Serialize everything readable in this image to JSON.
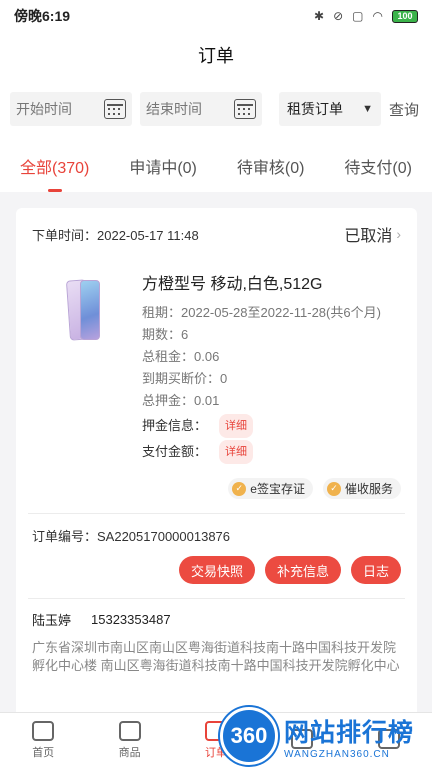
{
  "status_bar": {
    "time": "傍晚6:19",
    "battery": "100"
  },
  "header": {
    "title": "订单"
  },
  "filters": {
    "start_placeholder": "开始时间",
    "end_placeholder": "结束时间",
    "type_selected": "租赁订单",
    "query_label": "查询"
  },
  "tabs": [
    {
      "label": "全部(370)"
    },
    {
      "label": "申请中(0)"
    },
    {
      "label": "待审核(0)"
    },
    {
      "label": "待支付(0)"
    }
  ],
  "order": {
    "order_time": "下单时间：2022-05-17 11:48",
    "status": "已取消",
    "product_title": "方橙型号 移动,白色,512G",
    "rent_period": "租期：2022-05-28至2022-11-28(共6个月)",
    "installments": "期数：6",
    "total_rent": "总租金：0.06",
    "buyout_price": "到期买断价：0",
    "total_deposit": "总押金：0.01",
    "deposit_info_label": "押金信息：",
    "payment_label": "支付金额：",
    "detail_tag": "详细",
    "services": [
      "e签宝存证",
      "催收服务"
    ],
    "order_no": "订单编号：SA2205170000013876",
    "actions": [
      "交易快照",
      "补充信息",
      "日志"
    ],
    "contact_name": "陆玉婷",
    "contact_phone": "15323353487",
    "address": "广东省深圳市南山区南山区粤海街道科技南十路中国科技开发院孵化中心楼 南山区粤海街道科技南十路中国科技开发院孵化中心楼"
  },
  "bottom_nav": [
    {
      "label": "首页"
    },
    {
      "label": "商品"
    },
    {
      "label": "订单"
    },
    {
      "label": ""
    },
    {
      "label": ""
    }
  ],
  "watermark": {
    "circle": "360",
    "title": "网站排行榜",
    "sub": "WANGZHAN360.CN"
  },
  "colors": {
    "accent": "#e8433a",
    "button": "#ec4b41",
    "watermark": "#1a74d6"
  }
}
